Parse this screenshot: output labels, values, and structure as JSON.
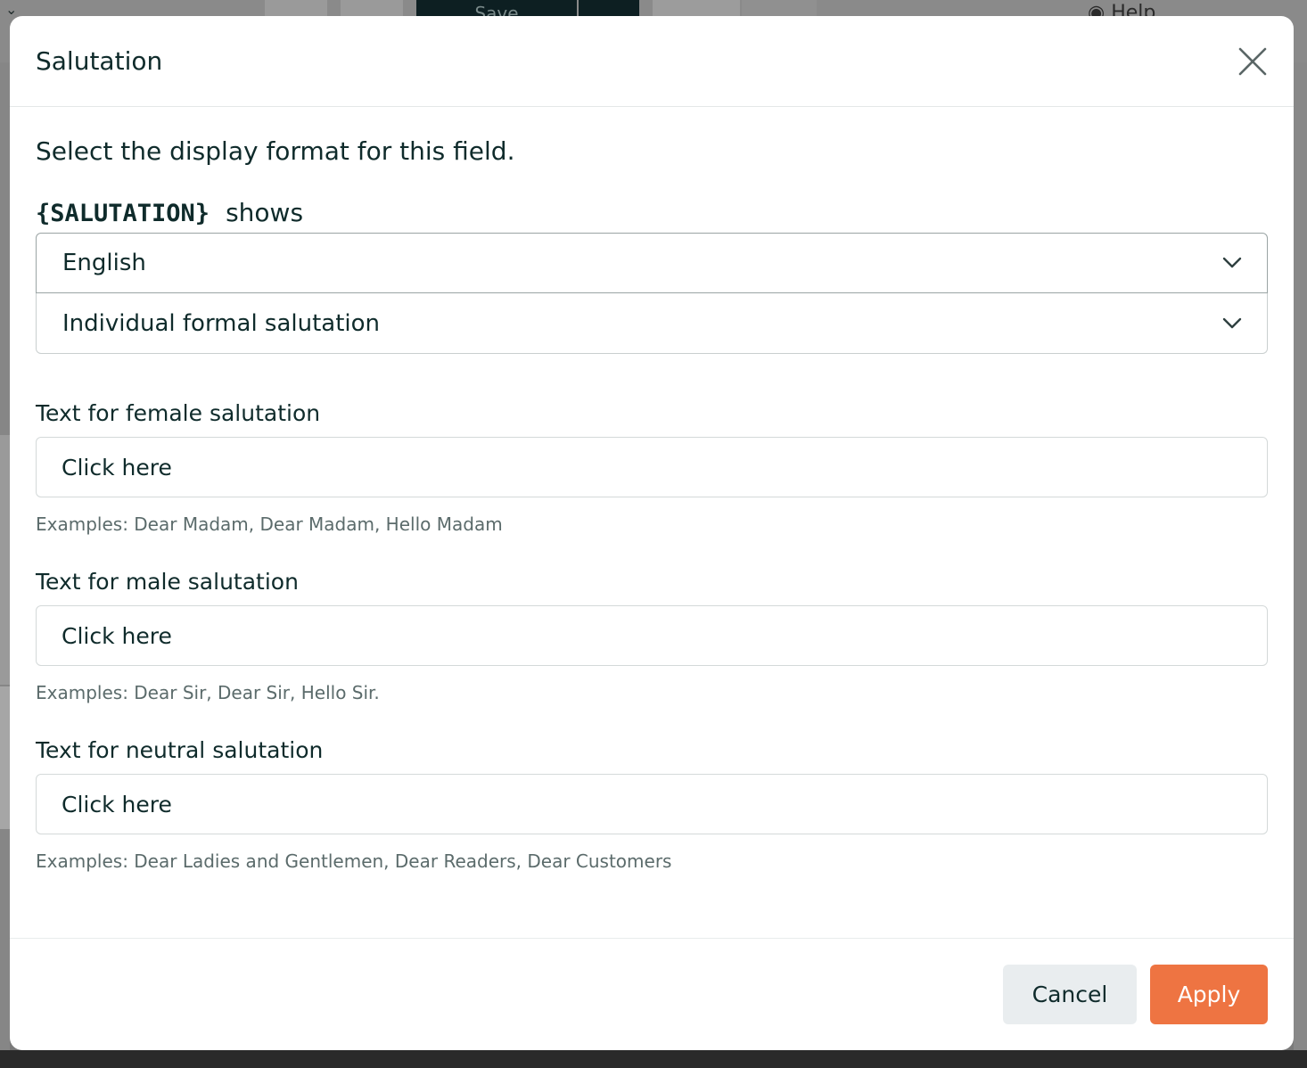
{
  "background": {
    "save_label": "Save",
    "help_label": "Help"
  },
  "modal": {
    "title": "Salutation",
    "intro": "Select the display format for this field.",
    "token": "{SALUTATION}",
    "shows": "shows",
    "language_select": {
      "value": "English"
    },
    "format_select": {
      "value": "Individual formal salutation"
    },
    "female": {
      "label": "Text for female salutation",
      "placeholder": "Click here",
      "hint": "Examples: Dear Madam, Dear Madam, Hello Madam"
    },
    "male": {
      "label": "Text for male salutation",
      "placeholder": "Click here",
      "hint": "Examples: Dear Sir, Dear Sir, Hello Sir."
    },
    "neutral": {
      "label": "Text for neutral salutation",
      "placeholder": "Click here",
      "hint": "Examples: Dear Ladies and Gentlemen, Dear Readers, Dear Customers"
    },
    "cancel_label": "Cancel",
    "apply_label": "Apply"
  },
  "colors": {
    "accent": "#ee7442",
    "text": "#0f2b2b",
    "hint": "#5b6b6b"
  }
}
